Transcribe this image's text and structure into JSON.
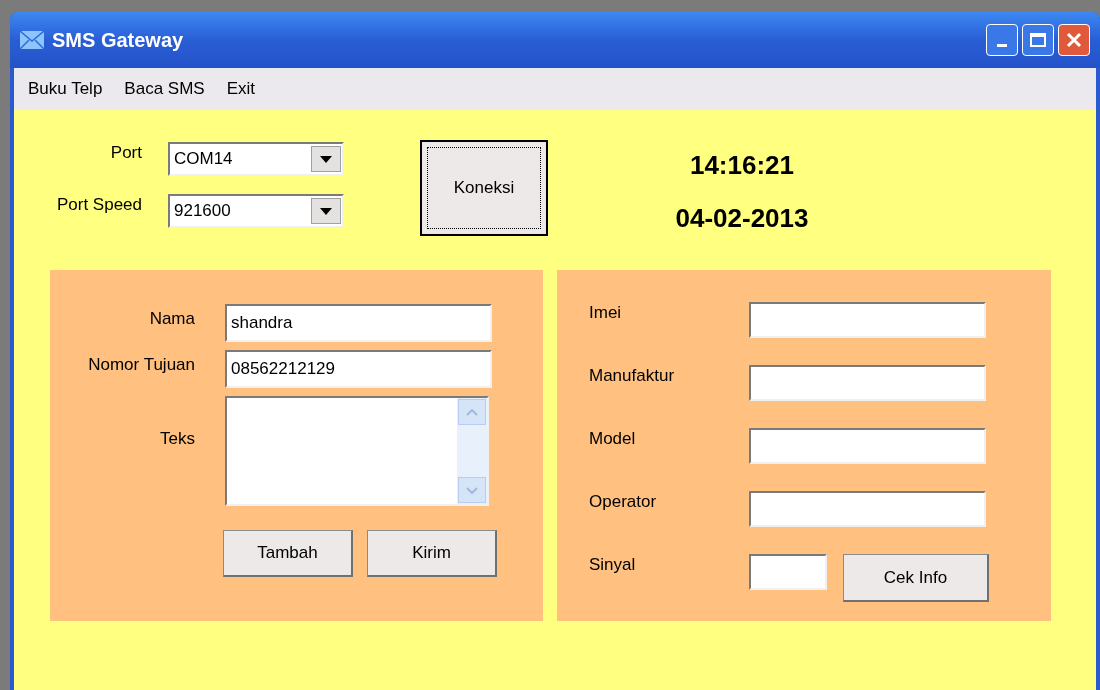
{
  "window": {
    "title": "SMS Gateway"
  },
  "menu": [
    {
      "label": "Buku Telp"
    },
    {
      "label": "Baca SMS"
    },
    {
      "label": "Exit"
    }
  ],
  "connection": {
    "fields": [
      {
        "label": "Port",
        "value": "COM14"
      },
      {
        "label": "Port Speed",
        "value": "921600"
      }
    ],
    "button": "Koneksi"
  },
  "clock": {
    "time": "14:16:21",
    "date": "04-02-2013"
  },
  "sms_form": {
    "fields": [
      {
        "kind": "text",
        "label": "Nama",
        "value": "shandra"
      },
      {
        "kind": "text",
        "label": "Nomor Tujuan",
        "value": "08562212129"
      },
      {
        "kind": "textarea",
        "label": "Teks"
      }
    ],
    "buttons": [
      "Tambah",
      "Kirim"
    ]
  },
  "info_form": {
    "fields": [
      {
        "label": "Imei"
      },
      {
        "label": "Manufaktur"
      },
      {
        "label": "Model"
      },
      {
        "label": "Operator"
      },
      {
        "label": "Sinyal"
      }
    ],
    "button": "Cek Info"
  }
}
